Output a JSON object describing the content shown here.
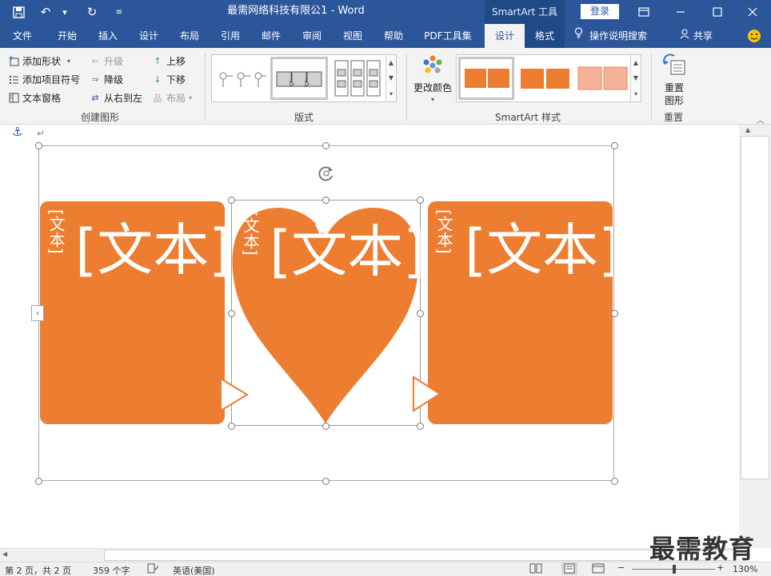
{
  "window": {
    "title": "最需网络科技有限公1  -  Word",
    "contextual_tab": "SmartArt 工具",
    "login_label": "登录",
    "accent_color": "#2b579a"
  },
  "tabs": [
    {
      "label": "文件"
    },
    {
      "label": "开始"
    },
    {
      "label": "插入"
    },
    {
      "label": "设计"
    },
    {
      "label": "布局"
    },
    {
      "label": "引用"
    },
    {
      "label": "邮件"
    },
    {
      "label": "审阅"
    },
    {
      "label": "视图"
    },
    {
      "label": "帮助"
    },
    {
      "label": "PDF工具集"
    },
    {
      "label": "设计"
    },
    {
      "label": "格式"
    }
  ],
  "tell_me": "操作说明搜索",
  "share_label": "共享",
  "ribbon": {
    "create_graphic": {
      "label": "创建图形",
      "add_shape": "添加形状",
      "add_bullet": "添加项目符号",
      "text_pane": "文本窗格",
      "promote": "升级",
      "demote": "降级",
      "right_to_left": "从右到左",
      "move_up": "上移",
      "move_down": "下移",
      "layout": "布局"
    },
    "layouts": {
      "label": "版式"
    },
    "smartart_styles": {
      "label": "SmartArt 样式",
      "change_colors": "更改颜色"
    },
    "reset": {
      "label": "重置",
      "reset_graphic": "重置\n图形",
      "line1": "重置",
      "line2": "图形"
    }
  },
  "document": {
    "shape_color": "#ed7d31",
    "placeholder": "[文本]",
    "vertical_placeholder": "[文本]"
  },
  "status": {
    "page": "第 2 页，共 2 页",
    "words": "359 个字",
    "language": "英语(美国)",
    "zoom": "130%"
  },
  "watermark": "最需教育"
}
